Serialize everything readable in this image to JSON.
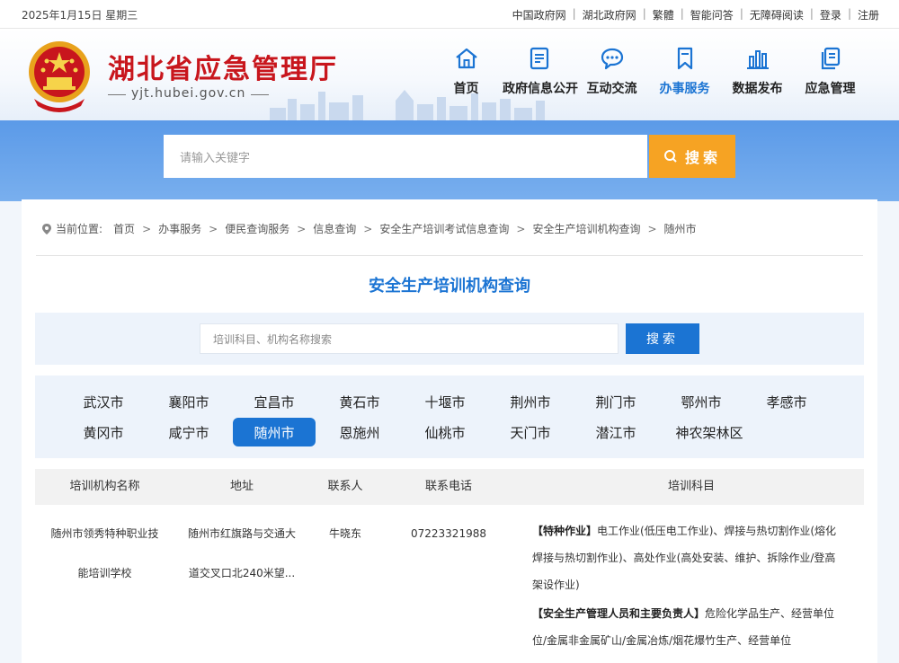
{
  "topbar": {
    "date": "2025年1月15日 星期三",
    "links": [
      "中国政府网",
      "湖北政府网",
      "繁體",
      "智能问答",
      "无障碍阅读",
      "登录",
      "注册"
    ]
  },
  "header": {
    "title": "湖北省应急管理厅",
    "domain": "yjt.hubei.gov.cn",
    "nav": [
      {
        "label": "首页",
        "icon": "home-icon"
      },
      {
        "label": "政府信息公开",
        "icon": "document-icon"
      },
      {
        "label": "互动交流",
        "icon": "chat-icon"
      },
      {
        "label": "办事服务",
        "icon": "bookmark-icon",
        "active": true
      },
      {
        "label": "数据发布",
        "icon": "bar-chart-icon"
      },
      {
        "label": "应急管理",
        "icon": "clipboard-icon"
      }
    ],
    "colors": {
      "title": "#c8161d",
      "active": "#1b74d3"
    }
  },
  "banner": {
    "search_placeholder": "请输入关键字",
    "search_button": "搜索"
  },
  "breadcrumb": {
    "prefix": "当前位置:",
    "items": [
      "首页",
      "办事服务",
      "便民查询服务",
      "信息查询",
      "安全生产培训考试信息查询",
      "安全生产培训机构查询",
      "随州市"
    ]
  },
  "page_title": "安全生产培训机构查询",
  "filter": {
    "placeholder": "培训科目、机构名称搜索",
    "button": "搜索"
  },
  "cities": {
    "row1": [
      "武汉市",
      "襄阳市",
      "宜昌市",
      "黄石市",
      "十堰市",
      "荆州市",
      "荆门市",
      "鄂州市",
      "孝感市"
    ],
    "row2": [
      "黄冈市",
      "咸宁市",
      "随州市",
      "恩施州",
      "仙桃市",
      "天门市",
      "潜江市",
      "神农架林区"
    ],
    "active": "随州市"
  },
  "table": {
    "headers": [
      "培训机构名称",
      "地址",
      "联系人",
      "联系电话",
      "培训科目"
    ],
    "rows": [
      {
        "name_line1": "随州市领秀特种职业技",
        "name_line2": "能培训学校",
        "addr_line1": "随州市红旗路与交通大",
        "addr_line2": "道交叉口北240米望...",
        "contact": "牛晓东",
        "phone": "07223321988",
        "subject1_tag": "【特种作业】",
        "subject1_line1": "电工作业(低压电工作业)、焊接与热切割作业(熔化",
        "subject1_line2": "焊接与热切割作业)、高处作业(高处安装、维护、拆除作业/登高",
        "subject1_line3": "架设作业)",
        "subject2_tag": "【安全生产管理人员和主要负责人】",
        "subject2_line1": "危险化学品生产、经营单位",
        "subject2_line2": "位/金属非金属矿山/金属冶炼/烟花爆竹生产、经营单位"
      }
    ]
  }
}
